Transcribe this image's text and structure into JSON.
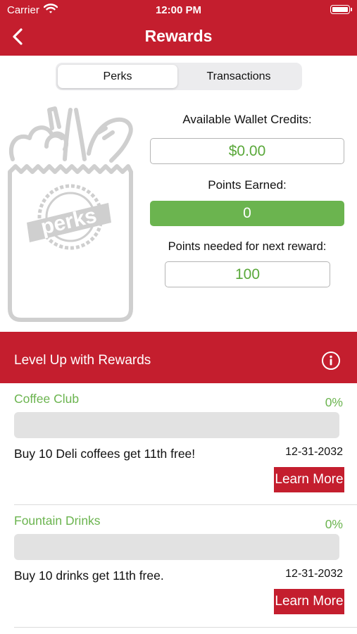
{
  "status_bar": {
    "carrier": "Carrier",
    "time": "12:00 PM"
  },
  "header": {
    "title": "Rewards"
  },
  "tabs": [
    {
      "label": "Perks",
      "active": true
    },
    {
      "label": "Transactions",
      "active": false
    }
  ],
  "bag_logo": {
    "text": "perks"
  },
  "summary": {
    "wallet_label": "Available Wallet Credits:",
    "wallet_value": "$0.00",
    "points_label": "Points Earned:",
    "points_value": "0",
    "needed_label": "Points needed for next reward:",
    "needed_value": "100"
  },
  "level_up": {
    "title": "Level Up with Rewards"
  },
  "rewards": [
    {
      "name": "Coffee Club",
      "percent": "0%",
      "progress": 0,
      "description": "Buy 10 Deli coffees get 11th free!",
      "expires": "12-31-2032",
      "button": "Learn More"
    },
    {
      "name": "Fountain Drinks",
      "percent": "0%",
      "progress": 0,
      "description": "Buy 10  drinks get 11th free.",
      "expires": "12-31-2032",
      "button": "Learn More"
    }
  ],
  "colors": {
    "brand_red": "#c41e2e",
    "accent_green": "#6bb44f",
    "value_green": "#5aa83a"
  }
}
